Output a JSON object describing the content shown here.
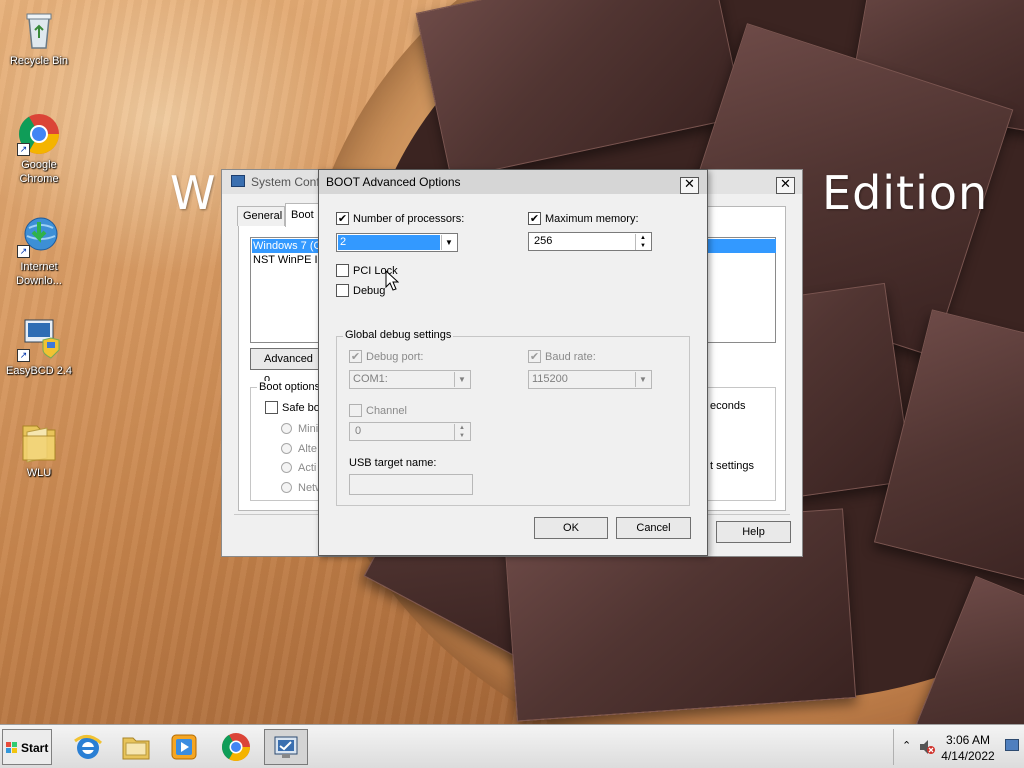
{
  "wallpaper": {
    "text_left": "W",
    "text_right": "Edition"
  },
  "desktop_icons": [
    {
      "label": "Recycle Bin",
      "icon": "recycle-bin-icon"
    },
    {
      "label": "Google Chrome",
      "icon": "chrome-icon"
    },
    {
      "label": "Internet Downlo...",
      "icon": "internet-download-manager-icon"
    },
    {
      "label": "EasyBCD 2.4",
      "icon": "easybcd-icon"
    },
    {
      "label": "WLU",
      "icon": "folder-icon"
    }
  ],
  "syscfg": {
    "title": "System Conf",
    "tabs": [
      "General",
      "Boot"
    ],
    "boot_entries": [
      "Windows 7 (C",
      "NST WinPE In"
    ],
    "advanced_button": "Advanced o",
    "boot_options_title": "Boot options",
    "safe_boot": "Safe bo",
    "safe_boot_options": [
      "Mini",
      "Alte",
      "Acti",
      "Netw"
    ],
    "seconds_fragment": "econds",
    "settings_fragment": "t settings",
    "help_button": "Help"
  },
  "advanced_dialog": {
    "title": "BOOT Advanced Options",
    "num_processors": {
      "label": "Number of processors:",
      "checked": true,
      "value": "2"
    },
    "max_memory": {
      "label": "Maximum memory:",
      "checked": true,
      "value": "256"
    },
    "pci_lock": {
      "label": "PCI Lock",
      "checked": false
    },
    "debug": {
      "label": "Debug",
      "checked": false
    },
    "global_debug": {
      "title": "Global debug settings",
      "debug_port": {
        "label": "Debug port:",
        "checked": true,
        "value": "COM1:"
      },
      "baud_rate": {
        "label": "Baud rate:",
        "checked": true,
        "value": "115200"
      },
      "channel": {
        "label": "Channel",
        "checked": false,
        "value": "0"
      },
      "usb_target": {
        "label": "USB target name:",
        "value": ""
      }
    },
    "ok_button": "OK",
    "cancel_button": "Cancel"
  },
  "taskbar": {
    "start_label": "Start",
    "apps": [
      "internet-explorer-icon",
      "file-explorer-icon",
      "media-player-icon",
      "chrome-icon",
      "system-configuration-icon"
    ],
    "clock_time": "3:06 AM",
    "clock_date": "4/14/2022"
  },
  "colors": {
    "selection_blue": "#3399ff",
    "title_active": "#dcdcdc",
    "title_inactive": "#e8e8e8",
    "taskbar": "#e6e6e6"
  }
}
